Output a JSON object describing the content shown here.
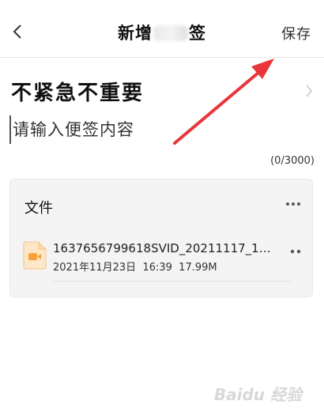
{
  "header": {
    "title_prefix": "新增",
    "title_suffix": "签",
    "save_label": "保存"
  },
  "category": {
    "label": "不紧急不重要"
  },
  "content": {
    "placeholder": "请输入便签内容",
    "value": "",
    "char_count": "(0/3000)"
  },
  "files": {
    "title": "文件",
    "items": [
      {
        "name": "1637656799618SVID_20211117_1…",
        "date": "2021年11月23日",
        "time": "16:39",
        "size": "17.99M",
        "icon": "video-file-icon"
      }
    ]
  },
  "colors": {
    "accent_arrow": "#e8363a",
    "file_icon_bg": "#fde7c8",
    "file_icon_fg": "#f5a23c"
  },
  "watermark": {
    "text": "Baidu 经验"
  }
}
